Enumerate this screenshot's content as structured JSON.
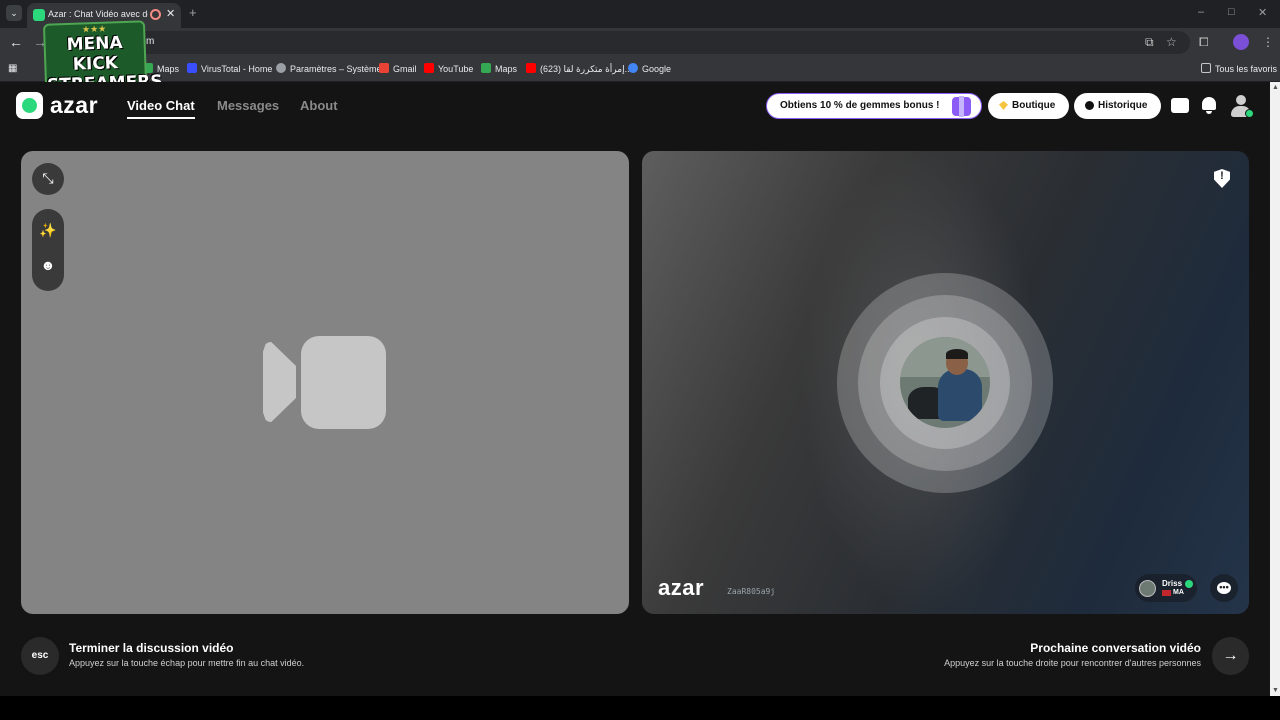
{
  "browser": {
    "tab_title": "Azar : Chat Vidéo avec de n",
    "tab_close": "✕",
    "new_tab": "+",
    "tab_menu": "⌄",
    "url": "m",
    "window_controls": {
      "minimize": "–",
      "maximize": "□",
      "close": "✕"
    },
    "bookmarks": [
      {
        "label": "Maps",
        "icon_color": "#34a853"
      },
      {
        "label": "VirusTotal - Home",
        "icon_color": "#394eff"
      },
      {
        "label": "Paramètres – Système",
        "icon_color": "#9aa0a6"
      },
      {
        "label": "Gmail",
        "icon_color": "#ea4335"
      },
      {
        "label": "YouTube",
        "icon_color": "#ff0000"
      },
      {
        "label": "Maps",
        "icon_color": "#34a853"
      },
      {
        "label": "(623) إمرأة متكررة لقا...",
        "icon_color": "#ff0000"
      },
      {
        "label": "Google",
        "icon_color": "#4285f4"
      }
    ],
    "all_bookmarks": "Tous les favoris"
  },
  "overlay_logo": {
    "line1": "MENA KICK",
    "line2": "STREAMERS",
    "stars": "★★★"
  },
  "header": {
    "brand": "azar",
    "nav": [
      {
        "label": "Video Chat",
        "active": true
      },
      {
        "label": "Messages",
        "active": false
      },
      {
        "label": "About",
        "active": false
      }
    ],
    "promo": "Obtiens 10 % de gemmes bonus !",
    "shop": "Boutique",
    "history": "Historique"
  },
  "remote": {
    "watermark": "azar",
    "session_id": "ZaaR805a9j",
    "peer_name": "Driss",
    "peer_country": "MA",
    "report_mark": "!",
    "chat_dots": "•••"
  },
  "actions": {
    "end_key": "esc",
    "end_title": "Terminer la discussion vidéo",
    "end_sub": "Appuyez sur la touche échap pour mettre fin au chat vidéo.",
    "next_title": "Prochaine conversation vidéo",
    "next_sub": "Appuyez sur la touche droite pour rencontrer d'autres personnes",
    "next_arrow": "→"
  },
  "local": {
    "minimize_glyph": "⤡",
    "effects_glyph": "✨",
    "sticker_glyph": "☻"
  },
  "colors": {
    "accent": "#2bd97c",
    "promo_border": "#8b5cf6",
    "page_bg": "#141414"
  }
}
